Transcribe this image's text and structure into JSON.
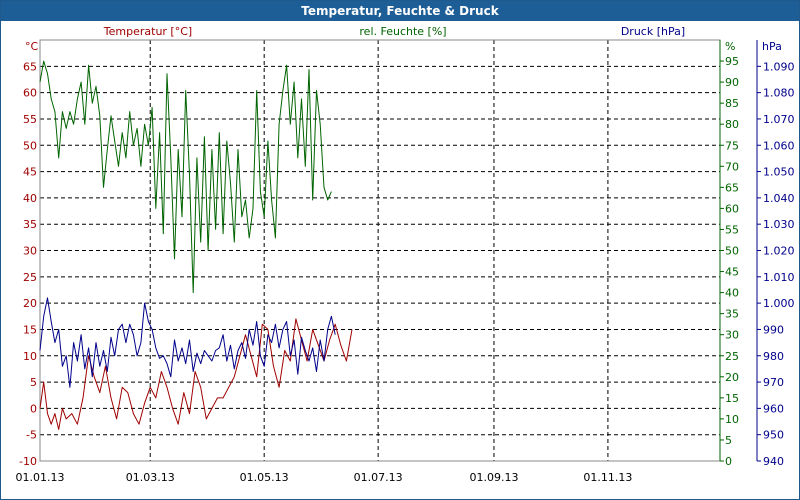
{
  "window": {
    "title": "Temperatur, Feuchte & Druck"
  },
  "colors": {
    "temperature": "#a00000",
    "humidity": "#006400",
    "pressure": "#00008b",
    "grid": "#000000",
    "titlebar": "#1e5e96"
  },
  "chart_data": {
    "type": "line",
    "title": "Temperatur, Feuchte & Druck",
    "grid": true,
    "x": {
      "type": "date",
      "range": [
        "01.01.13",
        "31.12.13"
      ],
      "ticks": [
        "01.01.13",
        "01.03.13",
        "01.05.13",
        "01.07.13",
        "01.09.13",
        "01.11.13"
      ]
    },
    "axes": {
      "temperature": {
        "label": "Temperatur [°C]",
        "unit": "°C",
        "range": [
          -10,
          70
        ],
        "ticks": [
          "-10",
          "-5",
          "0",
          "5",
          "10",
          "15",
          "20",
          "25",
          "30",
          "35",
          "40",
          "45",
          "50",
          "55",
          "60",
          "65"
        ]
      },
      "humidity": {
        "label": "rel. Feuchte [%]",
        "unit": "%",
        "range": [
          0,
          100
        ],
        "ticks": [
          "0",
          "5",
          "10",
          "15",
          "20",
          "25",
          "30",
          "35",
          "40",
          "45",
          "50",
          "55",
          "60",
          "65",
          "70",
          "75",
          "80",
          "85",
          "90",
          "95"
        ]
      },
      "pressure": {
        "label": "Druck [hPa]",
        "unit": "hPa",
        "range": [
          940,
          1100
        ],
        "ticks": [
          "940",
          "950",
          "960",
          "970",
          "980",
          "990",
          "1.000",
          "1.010",
          "1.020",
          "1.030",
          "1.040",
          "1.050",
          "1.060",
          "1.070",
          "1.080",
          "1.090"
        ]
      }
    },
    "series": [
      {
        "name": "Temperatur [°C]",
        "axis": "temperature",
        "color": "#a00000",
        "points": [
          [
            "01.01.13",
            0
          ],
          [
            "03.01.13",
            5
          ],
          [
            "05.01.13",
            -1
          ],
          [
            "07.01.13",
            -3
          ],
          [
            "09.01.13",
            -1
          ],
          [
            "11.01.13",
            -4
          ],
          [
            "13.01.13",
            0
          ],
          [
            "15.01.13",
            -2
          ],
          [
            "18.01.13",
            -1
          ],
          [
            "21.01.13",
            -3
          ],
          [
            "24.01.13",
            2
          ],
          [
            "27.01.13",
            10
          ],
          [
            "30.01.13",
            6
          ],
          [
            "02.02.13",
            3
          ],
          [
            "05.02.13",
            8
          ],
          [
            "08.02.13",
            2
          ],
          [
            "11.02.13",
            -2
          ],
          [
            "14.02.13",
            4
          ],
          [
            "17.02.13",
            3
          ],
          [
            "20.02.13",
            -1
          ],
          [
            "23.02.13",
            -3
          ],
          [
            "26.02.13",
            1
          ],
          [
            "01.03.13",
            4
          ],
          [
            "04.03.13",
            2
          ],
          [
            "07.03.13",
            7
          ],
          [
            "10.03.13",
            4
          ],
          [
            "13.03.13",
            0
          ],
          [
            "16.03.13",
            -3
          ],
          [
            "19.03.13",
            3
          ],
          [
            "22.03.13",
            -1
          ],
          [
            "25.03.13",
            7
          ],
          [
            "28.03.13",
            4
          ],
          [
            "31.03.13",
            -2
          ],
          [
            "03.04.13",
            0
          ],
          [
            "06.04.13",
            2
          ],
          [
            "09.04.13",
            2
          ],
          [
            "12.04.13",
            4
          ],
          [
            "15.04.13",
            6
          ],
          [
            "18.04.13",
            10
          ],
          [
            "21.04.13",
            14
          ],
          [
            "24.04.13",
            10
          ],
          [
            "27.04.13",
            6
          ],
          [
            "30.04.13",
            16
          ],
          [
            "03.05.13",
            15
          ],
          [
            "06.05.13",
            8
          ],
          [
            "09.05.13",
            4
          ],
          [
            "12.05.13",
            11
          ],
          [
            "15.05.13",
            9
          ],
          [
            "18.05.13",
            17
          ],
          [
            "21.05.13",
            13
          ],
          [
            "24.05.13",
            9
          ],
          [
            "27.05.13",
            15
          ],
          [
            "30.05.13",
            12
          ],
          [
            "02.06.13",
            9
          ],
          [
            "05.06.13",
            13
          ],
          [
            "08.06.13",
            16
          ],
          [
            "11.06.13",
            12
          ],
          [
            "14.06.13",
            9
          ],
          [
            "17.06.13",
            15
          ]
        ]
      },
      {
        "name": "rel. Feuchte [%]",
        "axis": "humidity",
        "color": "#006400",
        "points": [
          [
            "01.01.13",
            90
          ],
          [
            "03.01.13",
            95
          ],
          [
            "05.01.13",
            92
          ],
          [
            "07.01.13",
            86
          ],
          [
            "09.01.13",
            83
          ],
          [
            "11.01.13",
            72
          ],
          [
            "13.01.13",
            83
          ],
          [
            "15.01.13",
            79
          ],
          [
            "17.01.13",
            83
          ],
          [
            "19.01.13",
            80
          ],
          [
            "21.01.13",
            86
          ],
          [
            "23.01.13",
            90
          ],
          [
            "25.01.13",
            80
          ],
          [
            "27.01.13",
            94
          ],
          [
            "29.01.13",
            85
          ],
          [
            "31.01.13",
            89
          ],
          [
            "02.02.13",
            82
          ],
          [
            "04.02.13",
            65
          ],
          [
            "06.02.13",
            74
          ],
          [
            "08.02.13",
            82
          ],
          [
            "10.02.13",
            76
          ],
          [
            "12.02.13",
            70
          ],
          [
            "14.02.13",
            78
          ],
          [
            "16.02.13",
            72
          ],
          [
            "18.02.13",
            83
          ],
          [
            "20.02.13",
            75
          ],
          [
            "22.02.13",
            79
          ],
          [
            "24.02.13",
            70
          ],
          [
            "26.02.13",
            80
          ],
          [
            "28.02.13",
            75
          ],
          [
            "02.03.13",
            84
          ],
          [
            "04.03.13",
            60
          ],
          [
            "06.03.13",
            78
          ],
          [
            "08.03.13",
            54
          ],
          [
            "10.03.13",
            92
          ],
          [
            "12.03.13",
            72
          ],
          [
            "14.03.13",
            48
          ],
          [
            "16.03.13",
            74
          ],
          [
            "18.03.13",
            58
          ],
          [
            "20.03.13",
            88
          ],
          [
            "22.03.13",
            68
          ],
          [
            "24.03.13",
            40
          ],
          [
            "26.03.13",
            72
          ],
          [
            "28.03.13",
            52
          ],
          [
            "30.03.13",
            77
          ],
          [
            "01.04.13",
            50
          ],
          [
            "03.04.13",
            74
          ],
          [
            "05.04.13",
            55
          ],
          [
            "07.04.13",
            78
          ],
          [
            "09.04.13",
            54
          ],
          [
            "11.04.13",
            76
          ],
          [
            "13.04.13",
            66
          ],
          [
            "15.04.13",
            52
          ],
          [
            "17.04.13",
            74
          ],
          [
            "19.04.13",
            58
          ],
          [
            "21.04.13",
            62
          ],
          [
            "23.04.13",
            53
          ],
          [
            "25.04.13",
            60
          ],
          [
            "27.04.13",
            88
          ],
          [
            "29.04.13",
            64
          ],
          [
            "01.05.13",
            58
          ],
          [
            "03.05.13",
            76
          ],
          [
            "05.05.13",
            62
          ],
          [
            "07.05.13",
            53
          ],
          [
            "09.05.13",
            80
          ],
          [
            "11.05.13",
            88
          ],
          [
            "13.05.13",
            94
          ],
          [
            "15.05.13",
            80
          ],
          [
            "17.05.13",
            90
          ],
          [
            "19.05.13",
            72
          ],
          [
            "21.05.13",
            86
          ],
          [
            "23.05.13",
            70
          ],
          [
            "25.05.13",
            93
          ],
          [
            "27.05.13",
            62
          ],
          [
            "29.05.13",
            88
          ],
          [
            "31.05.13",
            80
          ],
          [
            "02.06.13",
            65
          ],
          [
            "04.06.13",
            62
          ],
          [
            "06.06.13",
            64
          ]
        ]
      },
      {
        "name": "Druck [hPa]",
        "axis": "pressure",
        "color": "#00008b",
        "points": [
          [
            "01.01.13",
            982
          ],
          [
            "03.01.13",
            995
          ],
          [
            "05.01.13",
            1002
          ],
          [
            "07.01.13",
            993
          ],
          [
            "09.01.13",
            985
          ],
          [
            "11.01.13",
            990
          ],
          [
            "13.01.13",
            976
          ],
          [
            "15.01.13",
            980
          ],
          [
            "17.01.13",
            968
          ],
          [
            "19.01.13",
            985
          ],
          [
            "21.01.13",
            978
          ],
          [
            "23.01.13",
            988
          ],
          [
            "25.01.13",
            975
          ],
          [
            "27.01.13",
            983
          ],
          [
            "29.01.13",
            972
          ],
          [
            "31.01.13",
            985
          ],
          [
            "02.02.13",
            976
          ],
          [
            "04.02.13",
            982
          ],
          [
            "06.02.13",
            974
          ],
          [
            "08.02.13",
            987
          ],
          [
            "10.02.13",
            980
          ],
          [
            "12.02.13",
            990
          ],
          [
            "14.02.13",
            992
          ],
          [
            "16.02.13",
            985
          ],
          [
            "18.02.13",
            992
          ],
          [
            "20.02.13",
            988
          ],
          [
            "22.02.13",
            980
          ],
          [
            "24.02.13",
            985
          ],
          [
            "26.02.13",
            1000
          ],
          [
            "28.02.13",
            993
          ],
          [
            "02.03.13",
            990
          ],
          [
            "04.03.13",
            983
          ],
          [
            "06.03.13",
            979
          ],
          [
            "08.03.13",
            980
          ],
          [
            "10.03.13",
            977
          ],
          [
            "12.03.13",
            972
          ],
          [
            "14.03.13",
            986
          ],
          [
            "16.03.13",
            978
          ],
          [
            "18.03.13",
            983
          ],
          [
            "20.03.13",
            977
          ],
          [
            "22.03.13",
            986
          ],
          [
            "24.03.13",
            974
          ],
          [
            "26.03.13",
            981
          ],
          [
            "28.03.13",
            977
          ],
          [
            "30.03.13",
            982
          ],
          [
            "01.04.13",
            980
          ],
          [
            "03.04.13",
            978
          ],
          [
            "05.04.13",
            982
          ],
          [
            "07.04.13",
            983
          ],
          [
            "09.04.13",
            988
          ],
          [
            "11.04.13",
            978
          ],
          [
            "13.04.13",
            984
          ],
          [
            "15.04.13",
            975
          ],
          [
            "17.04.13",
            982
          ],
          [
            "19.04.13",
            985
          ],
          [
            "21.04.13",
            979
          ],
          [
            "23.04.13",
            990
          ],
          [
            "25.04.13",
            984
          ],
          [
            "27.04.13",
            993
          ],
          [
            "29.04.13",
            980
          ],
          [
            "01.05.13",
            976
          ],
          [
            "03.05.13",
            988
          ],
          [
            "05.05.13",
            985
          ],
          [
            "07.05.13",
            992
          ],
          [
            "09.05.13",
            983
          ],
          [
            "11.05.13",
            990
          ],
          [
            "13.05.13",
            993
          ],
          [
            "15.05.13",
            980
          ],
          [
            "17.05.13",
            986
          ],
          [
            "19.05.13",
            973
          ],
          [
            "21.05.13",
            987
          ],
          [
            "23.05.13",
            982
          ],
          [
            "25.05.13",
            978
          ],
          [
            "27.05.13",
            983
          ],
          [
            "29.05.13",
            974
          ],
          [
            "31.05.13",
            986
          ],
          [
            "02.06.13",
            978
          ],
          [
            "04.06.13",
            990
          ],
          [
            "06.06.13",
            995
          ],
          [
            "08.06.13",
            988
          ]
        ]
      }
    ]
  }
}
